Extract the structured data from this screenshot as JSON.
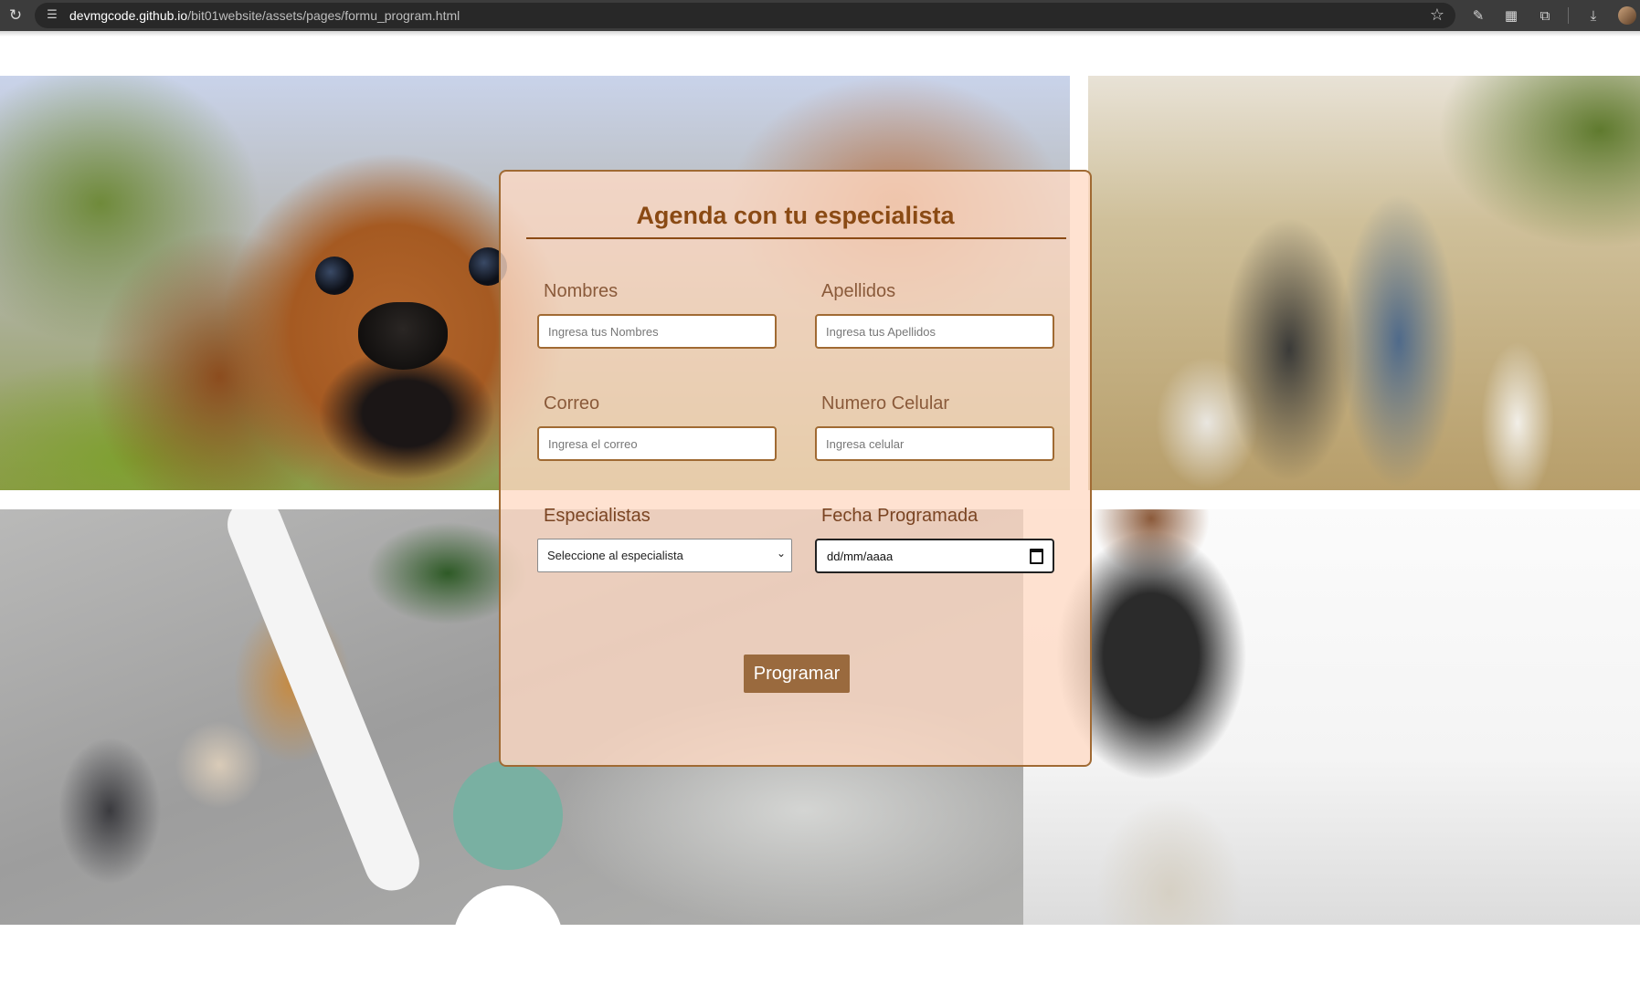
{
  "browser": {
    "url_host": "devmgcode.github.io",
    "url_path": "/bit01website/assets/pages/formu_program.html",
    "icons": [
      "reload-icon",
      "site-settings-icon",
      "bookmark-star-icon",
      "eyedropper-icon",
      "qr-code-icon",
      "extensions-icon",
      "download-icon",
      "profile-avatar"
    ]
  },
  "form": {
    "title": "Agenda con tu especialista",
    "nombres": {
      "label": "Nombres",
      "placeholder": "Ingresa tus Nombres"
    },
    "apellidos": {
      "label": "Apellidos",
      "placeholder": "Ingresa tus Apellidos"
    },
    "correo": {
      "label": "Correo",
      "placeholder": "Ingresa el correo"
    },
    "celular": {
      "label": "Numero Celular",
      "placeholder": "Ingresa celular"
    },
    "especialistas": {
      "label": "Especialistas",
      "selected": "Seleccione al especialista"
    },
    "fecha": {
      "label": "Fecha Programada",
      "value": "dd/mm/aaaa"
    },
    "submit_label": "Programar"
  },
  "colors": {
    "card_bg": "#ffdac4",
    "accent_brown": "#8a4a14",
    "button_bg": "#9a6a3e",
    "teal_circle": "#79b0a2"
  }
}
